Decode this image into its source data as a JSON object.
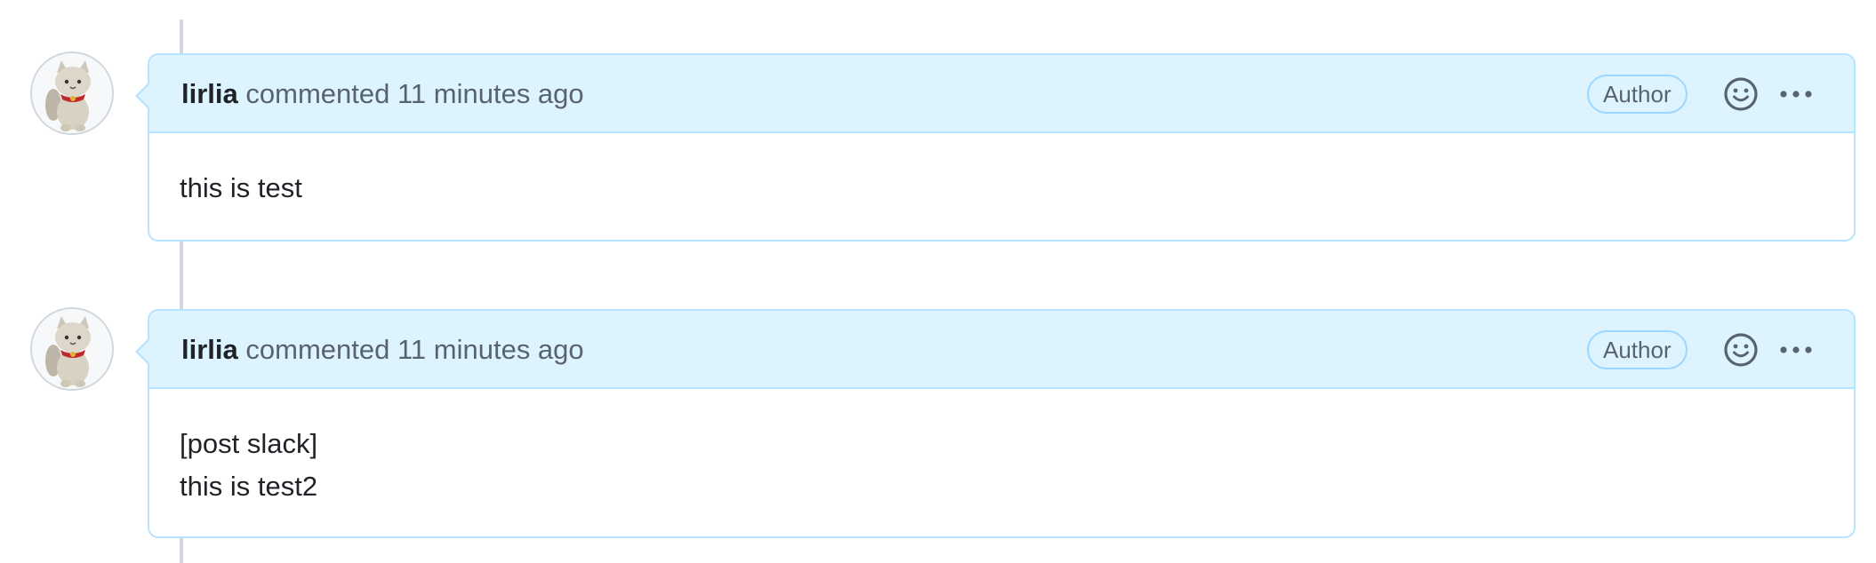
{
  "comments": [
    {
      "author": "lirlia",
      "action": "commented",
      "time": "11 minutes ago",
      "badge": "Author",
      "body": [
        "this is test"
      ]
    },
    {
      "author": "lirlia",
      "action": "commented",
      "time": "11 minutes ago",
      "badge": "Author",
      "body": [
        "[post slack]",
        "this is test2"
      ]
    }
  ],
  "icons": {
    "avatar": "cat-avatar-icon",
    "reaction": "smiley-icon",
    "menu": "kebab-horizontal-icon"
  },
  "colors": {
    "header_bg": "#ddf4ff",
    "border": "#b6e3ff",
    "timeline": "#d0d7de",
    "text": "#1f2328",
    "muted": "#59636e"
  }
}
